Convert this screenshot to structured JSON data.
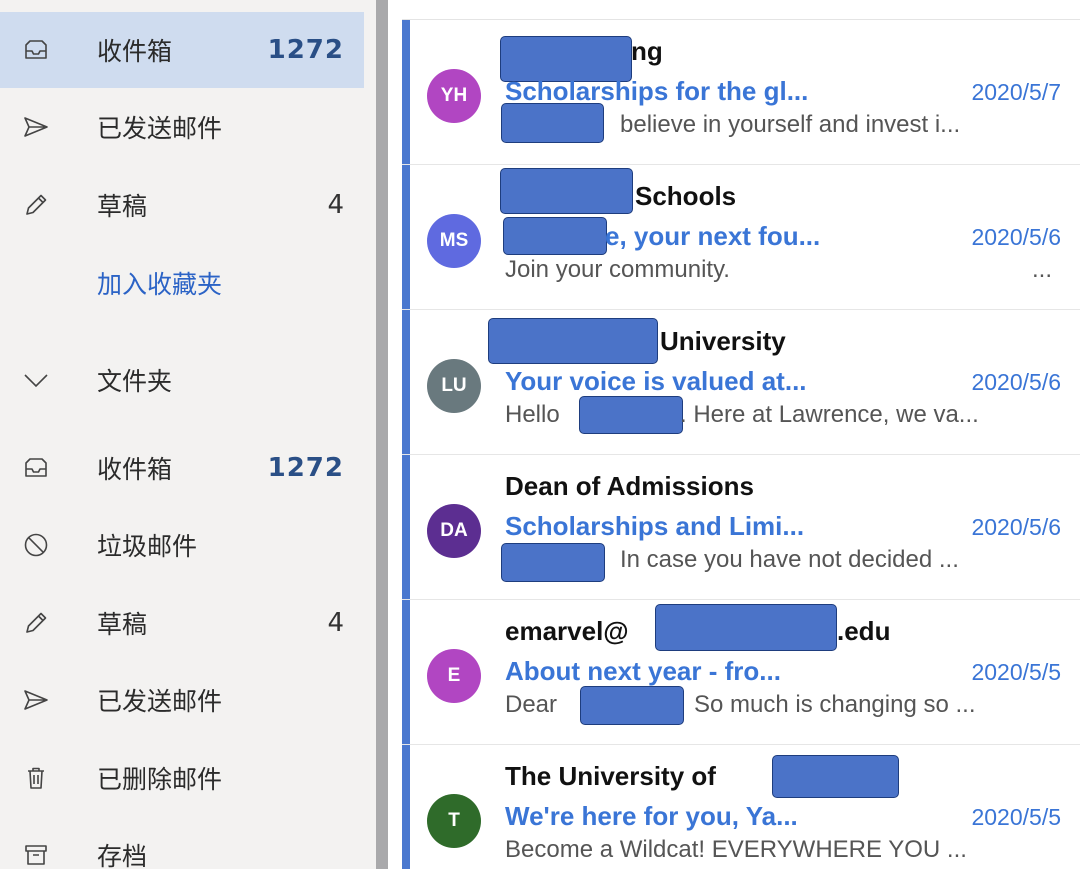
{
  "sidebar": {
    "items": [
      {
        "icon": "inbox-icon",
        "label": "收件箱",
        "count": "1272",
        "selected": true
      },
      {
        "icon": "send-icon",
        "label": "已发送邮件",
        "count": ""
      },
      {
        "icon": "pencil-icon",
        "label": "草稿",
        "count": "4"
      },
      {
        "icon": "",
        "label": "加入收藏夹",
        "count": "",
        "link": true
      },
      {
        "icon": "chevron-down-icon",
        "label": "文件夹",
        "count": ""
      },
      {
        "icon": "inbox-icon",
        "label": "收件箱",
        "count": "1272"
      },
      {
        "icon": "block-icon",
        "label": "垃圾邮件",
        "count": ""
      },
      {
        "icon": "pencil-icon",
        "label": "草稿",
        "count": "4"
      },
      {
        "icon": "send-icon",
        "label": "已发送邮件",
        "count": ""
      },
      {
        "icon": "trash-icon",
        "label": "已删除邮件",
        "count": ""
      },
      {
        "icon": "archive-icon",
        "label": "存档",
        "count": ""
      }
    ]
  },
  "messages": [
    {
      "initials": "YH",
      "avatar_color": "#b146c2",
      "sender": "ng",
      "subject": "Scholarships for the gl...",
      "date": "2020/5/7",
      "preview": "believe in yourself and invest i..."
    },
    {
      "initials": "MS",
      "avatar_color": "#5f6ae0",
      "sender": "Schools",
      "subject": "e, your next fou...",
      "date": "2020/5/6",
      "preview": "Join your community.",
      "preview_end": "..."
    },
    {
      "initials": "LU",
      "avatar_color": "#69797e",
      "sender": "University",
      "subject": "Your voice is valued at...",
      "date": "2020/5/6",
      "preview_a": "Hello",
      "preview_b": ". Here at Lawrence, we va..."
    },
    {
      "initials": "DA",
      "avatar_color": "#5c2e91",
      "sender": "Dean of Admissions",
      "subject": "Scholarships and Limi...",
      "date": "2020/5/6",
      "preview": "In case you have not decided ..."
    },
    {
      "initials": "E",
      "avatar_color": "#b146c2",
      "sender_a": "emarvel@",
      "sender_b": ".edu",
      "subject": "About next year - fro...",
      "date": "2020/5/5",
      "preview_a": "Dear",
      "preview_b": "So much is changing so ..."
    },
    {
      "initials": "T",
      "avatar_color": "#2f6b2a",
      "sender": "The University of",
      "subject": "We're here for you, Ya...",
      "date": "2020/5/5",
      "preview": "Become a Wildcat! EVERYWHERE YOU ..."
    }
  ],
  "colors": {
    "accent": "#4a78cf",
    "link": "#3a75d6",
    "selected_bg": "#cfdcef",
    "sidebar_bg": "#f3f2f1",
    "redaction": "#4b73c8"
  }
}
